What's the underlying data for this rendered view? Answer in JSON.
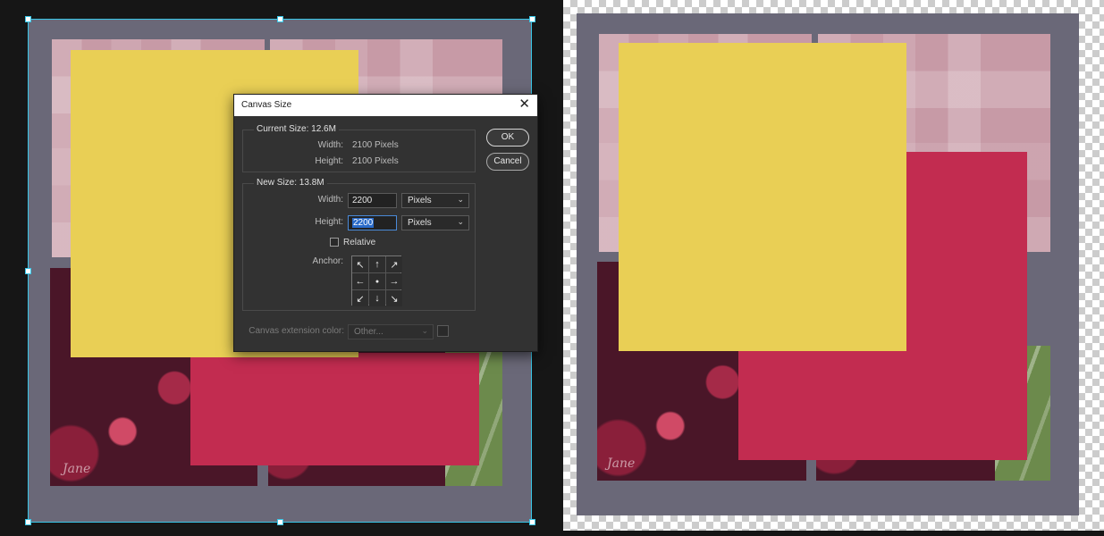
{
  "dialog": {
    "title": "Canvas Size",
    "close_glyph": "✕",
    "current": {
      "title": "Current Size: 12.6M",
      "width_label": "Width:",
      "width_value": "2100 Pixels",
      "height_label": "Height:",
      "height_value": "2100 Pixels"
    },
    "new": {
      "title": "New Size: 13.8M",
      "width_label": "Width:",
      "width_value": "2200",
      "width_unit": "Pixels",
      "height_label": "Height:",
      "height_value": "2200",
      "height_unit": "Pixels",
      "relative_label": "Relative",
      "relative_checked": false,
      "anchor_label": "Anchor:",
      "anchor_arrows": [
        "↖",
        "↑",
        "↗",
        "←",
        "●",
        "→",
        "↙",
        "↓",
        "↘"
      ]
    },
    "extension": {
      "label": "Canvas extension color:",
      "value": "Other..."
    },
    "ok_label": "OK",
    "cancel_label": "Cancel",
    "chevron": "⌄"
  },
  "colors": {
    "selection": "#38c7e8",
    "yellow_block": "#e9cf55",
    "red_block": "#c22c50",
    "mat": "#6a6878"
  },
  "signature_text": "Jane"
}
